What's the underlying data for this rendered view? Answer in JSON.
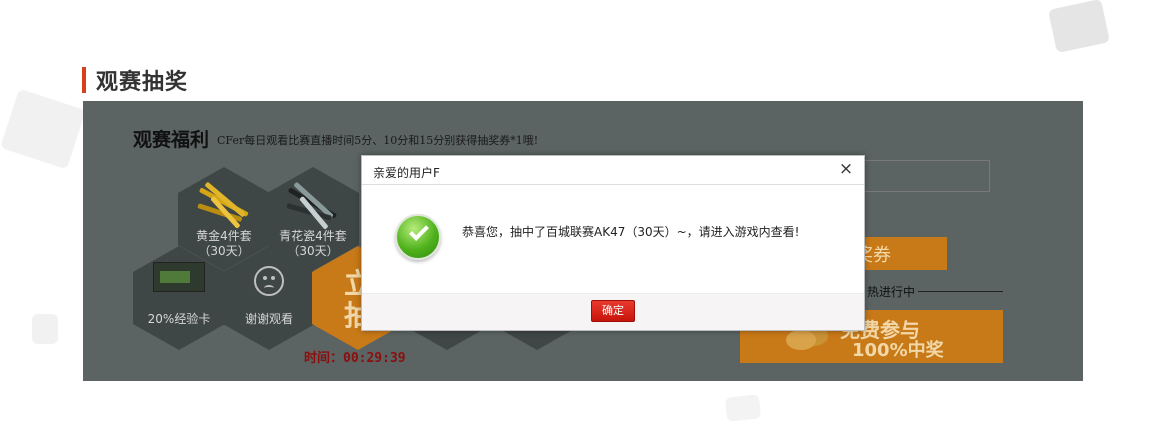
{
  "section": {
    "title": "观赛抽奖"
  },
  "panel": {
    "welfare_title": "观赛福利",
    "welfare_subtitle": "CFer每日观看比赛直播时间5分、10分和15分别获得抽奖券*1哦!",
    "prizes": [
      {
        "name": "黄金4件套",
        "duration": "（30天）",
        "icon": "gold-weapons-icon"
      },
      {
        "name": "青花瓷4件套",
        "duration": "（30天）",
        "icon": "porcelain-weapons-icon"
      },
      {
        "name": "20%经验卡",
        "icon": "exp-card-icon"
      },
      {
        "name": "谢谢观看",
        "icon": "sad-face-icon"
      }
    ],
    "draw_button": {
      "line1": "立",
      "line2": "抽"
    },
    "timer": "时间：00:29:39",
    "coupon_button": "抽奖券",
    "hot_text": "热进行中",
    "free_banner": {
      "line1": "免费参与",
      "line2": "100%中奖"
    }
  },
  "dialog": {
    "title": "亲爱的用户F",
    "message": "恭喜您，抽中了百城联赛AK47（30天）~，请进入游戏内查看!",
    "confirm_label": "确定",
    "close_icon": "close-icon",
    "status_icon": "success-check-icon"
  },
  "colors": {
    "accent": "#d8401c",
    "panel_bg": "#5b6363",
    "orange": "#c97a18",
    "confirm_red": "#e02a1f",
    "timer_red": "#8b0f0f"
  }
}
